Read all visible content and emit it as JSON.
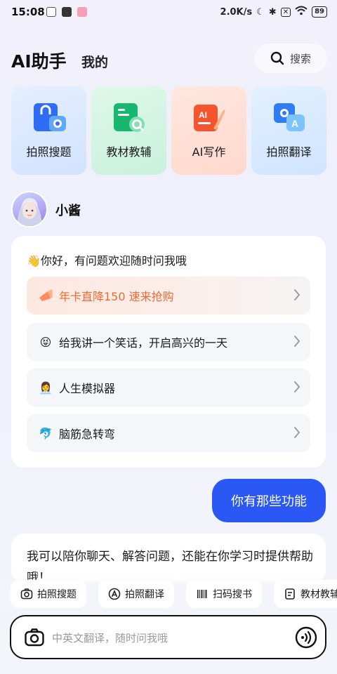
{
  "status_bar": {
    "time": "15:08",
    "net_speed": "2.0K/s",
    "battery": "89"
  },
  "header": {
    "title": "AI助手",
    "tab_mine": "我的",
    "search_label": "搜索"
  },
  "feature_cards": [
    {
      "label": "拍照搜题",
      "bg": "#dbe9ff",
      "icon": "camera-search-icon"
    },
    {
      "label": "教材教辅",
      "bg": "#d6f5e6",
      "icon": "textbook-icon"
    },
    {
      "label": "AI写作",
      "bg": "#ffe3da",
      "icon": "ai-writing-icon"
    },
    {
      "label": "拍照翻译",
      "bg": "#dcecff",
      "icon": "camera-translate-icon"
    }
  ],
  "bot": {
    "name": "小酱"
  },
  "greeting": {
    "text": "👋你好，有问题欢迎随时问我哦",
    "items": [
      {
        "emoji": "",
        "label": "年卡直降150 速来抢购",
        "promo": true
      },
      {
        "emoji": "😝",
        "label": "给我讲一个笑话，开启高兴的一天"
      },
      {
        "emoji": "👩‍💼",
        "label": "人生模拟器"
      },
      {
        "emoji": "🐬",
        "label": "脑筋急转弯"
      }
    ]
  },
  "user_message": "你有那些功能",
  "bot_reply": "我可以陪你聊天、解答问题，还能在你学习时提供帮助哦！",
  "shortcuts": [
    {
      "label": "拍照搜题",
      "icon": "camera-icon"
    },
    {
      "label": "拍照翻译",
      "icon": "translate-icon"
    },
    {
      "label": "扫码搜书",
      "icon": "barcode-icon"
    },
    {
      "label": "教材教辅",
      "icon": "book-icon"
    }
  ],
  "input": {
    "placeholder": "中英文翻译，随时问我哦"
  },
  "colors": {
    "accent": "#2b57f5",
    "promo": "#f06a34"
  }
}
